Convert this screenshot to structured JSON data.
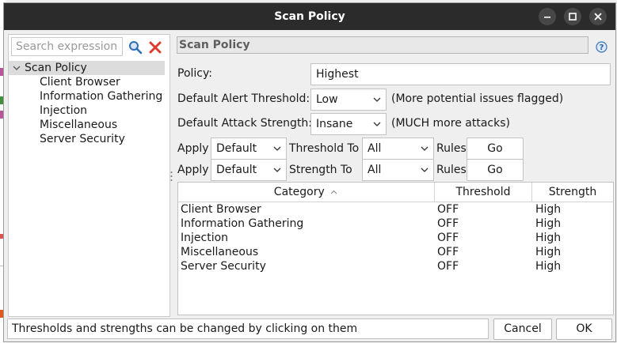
{
  "window": {
    "title": "Scan Policy"
  },
  "title_buttons": {
    "minimize": "−",
    "maximize": "□",
    "close": "✕"
  },
  "search": {
    "placeholder": "Search expression",
    "value": ""
  },
  "icons": {
    "search": "magnifier-icon",
    "clear": "red-x-icon",
    "help": "help-icon",
    "sort": "sort-ascending-icon",
    "chevron": "chevron-down-icon"
  },
  "tree": {
    "root": "Scan Policy",
    "children": [
      "Client Browser",
      "Information Gathering",
      "Injection",
      "Miscellaneous",
      "Server Security"
    ]
  },
  "panel": {
    "header": "Scan Policy"
  },
  "form": {
    "policy_label": "Policy:",
    "policy_value": "Highest",
    "threshold_label": "Default Alert Threshold:",
    "threshold_value": "Low",
    "threshold_note": "(More potential issues flagged)",
    "strength_label": "Default Attack Strength:",
    "strength_value": "Insane",
    "strength_note": "(MUCH more attacks)"
  },
  "apply_rows": [
    {
      "apply": "Apply",
      "scope": "Default",
      "target": "Threshold To",
      "level": "All",
      "rules": "Rules",
      "go": "Go"
    },
    {
      "apply": "Apply",
      "scope": "Default",
      "target": "Strength To",
      "level": "All",
      "rules": "Rules",
      "go": "Go"
    }
  ],
  "table": {
    "columns": [
      "Category",
      "Threshold",
      "Strength"
    ],
    "rows": [
      [
        "Client Browser",
        "OFF",
        "High"
      ],
      [
        "Information Gathering",
        "OFF",
        "High"
      ],
      [
        "Injection",
        "OFF",
        "High"
      ],
      [
        "Miscellaneous",
        "OFF",
        "High"
      ],
      [
        "Server Security",
        "OFF",
        "High"
      ]
    ]
  },
  "status": "Thresholds and strengths can be changed by clicking on them",
  "buttons": {
    "cancel": "Cancel",
    "ok": "OK"
  },
  "colors": {
    "titlebar": "#2b2b2b",
    "clear_icon": "#e03a2f",
    "search_icon": "#2d6fb5",
    "selection": "#dcdcdc"
  }
}
